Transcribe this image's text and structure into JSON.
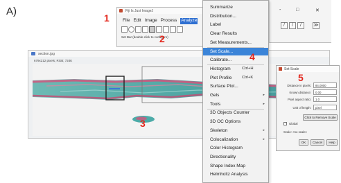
{
  "figure": {
    "panel_label": "A)",
    "callouts": [
      "1",
      "2",
      "3",
      "4",
      "5"
    ],
    "callout_color": "#e3261c"
  },
  "imagej": {
    "window_title": "Fiji Is Just ImageJ",
    "menus": [
      "File",
      "Edit",
      "Image",
      "Process",
      "Analyze"
    ],
    "active_menu": "Analyze",
    "status_text": "Set Bar (double-click to configure)",
    "tool_icons": [
      "rectangle-tool-icon",
      "oval-tool-icon",
      "polygon-tool-icon",
      "freehand-tool-icon",
      "straight-line-tool-icon",
      "angle-tool-icon",
      "point-tool-icon",
      "wand-tool-icon",
      "text-tool-icon"
    ]
  },
  "right_strip": {
    "window_buttons": [
      "-",
      "□",
      "✕"
    ],
    "tools": [
      "/",
      "/",
      "/",
      "≫"
    ]
  },
  "image_window": {
    "title": "section.jpg",
    "info": "679x212 pixels; RGB; 724K",
    "stain_colors": {
      "tissue": "#3aa3a0",
      "pink": "#d2557c",
      "selection": "#222222"
    }
  },
  "analyze_menu": {
    "items": [
      {
        "label": "Summarize",
        "shortcut": "",
        "submenu": false
      },
      {
        "label": "Distribution...",
        "shortcut": "",
        "submenu": false
      },
      {
        "label": "Label",
        "shortcut": "",
        "submenu": false
      },
      {
        "label": "Clear Results",
        "shortcut": "",
        "submenu": false
      },
      {
        "label": "Set Measurements...",
        "shortcut": "",
        "submenu": false
      },
      {
        "label": "Set Scale...",
        "shortcut": "",
        "submenu": false,
        "highlighted": true
      },
      {
        "label": "Calibrate...",
        "shortcut": "",
        "submenu": false
      },
      {
        "label": "Histogram",
        "shortcut": "Ctrl+H",
        "submenu": false
      },
      {
        "label": "Plot Profile",
        "shortcut": "Ctrl+K",
        "submenu": false
      },
      {
        "label": "Surface Plot...",
        "shortcut": "",
        "submenu": false
      },
      {
        "label": "Gels",
        "shortcut": "",
        "submenu": true
      },
      {
        "label": "Tools",
        "shortcut": "",
        "submenu": true
      },
      {
        "label": "3D Objects Counter",
        "shortcut": "",
        "submenu": false
      },
      {
        "label": "3D OC Options",
        "shortcut": "",
        "submenu": false
      },
      {
        "label": "Skeleton",
        "shortcut": "",
        "submenu": true
      },
      {
        "label": "Colocalization",
        "shortcut": "",
        "submenu": true
      },
      {
        "label": "Color Histogram",
        "shortcut": "",
        "submenu": false
      },
      {
        "label": "Directionality",
        "shortcut": "",
        "submenu": false
      },
      {
        "label": "Shape Index Map",
        "shortcut": "",
        "submenu": false
      },
      {
        "label": "Helmholtz Analysis",
        "shortcut": "",
        "submenu": false
      }
    ]
  },
  "set_scale_dialog": {
    "title": "Set Scale",
    "fields": [
      {
        "label": "Distance in pixels:",
        "value": "84.0000"
      },
      {
        "label": "Known distance:",
        "value": "0.00"
      },
      {
        "label": "Pixel aspect ratio:",
        "value": "1.0"
      },
      {
        "label": "Unit of length:",
        "value": "pixel"
      }
    ],
    "click_to_remove": "Click to Remove Scale",
    "global_label": "Global",
    "scale_text": "Scale: <no scale>",
    "buttons": {
      "ok": "OK",
      "cancel": "Cancel",
      "help": "Help"
    }
  }
}
